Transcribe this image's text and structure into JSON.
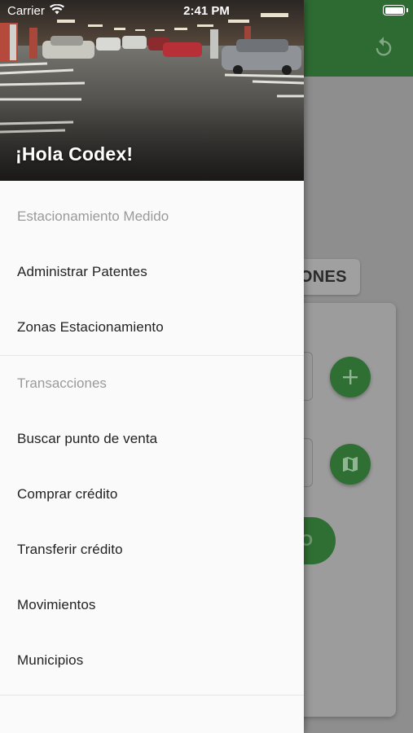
{
  "status_bar": {
    "carrier": "Carrier",
    "time": "2:41 PM"
  },
  "colors": {
    "primary": "#2e6b33",
    "drawer_bg": "#fafafa",
    "section_header": "#9a9a9a",
    "scrim": "#8e8e8e"
  },
  "drawer": {
    "greeting": "¡Hola Codex!",
    "sections": [
      {
        "title": "Estacionamiento Medido",
        "items": [
          "Administrar Patentes",
          "Zonas Estacionamiento"
        ]
      },
      {
        "title": "Transacciones",
        "items": [
          "Buscar punto de venta",
          "Comprar crédito",
          "Transferir crédito",
          "Movimientos",
          "Municipios"
        ]
      }
    ]
  },
  "background": {
    "tab_label": "IONES",
    "button_label": "O"
  },
  "icons": {
    "app_bar_action": "refresh-icon",
    "fab_1": "plus-icon",
    "fab_2": "map-icon",
    "status": [
      "wifi-icon",
      "battery-icon"
    ]
  }
}
